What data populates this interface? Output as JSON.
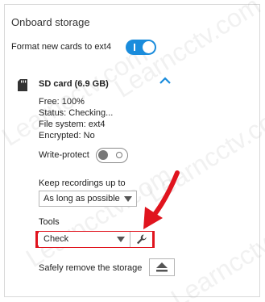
{
  "storage": {
    "title": "Onboard storage",
    "format_label": "Format new cards to ext4",
    "format_enabled": true
  },
  "sd_card": {
    "title": "SD card (6.9 GB)",
    "expanded": true,
    "info": [
      "Free: 100%",
      "Status: Checking...",
      "File system: ext4",
      "Encrypted: No"
    ],
    "write_protect_label": "Write-protect",
    "write_protect_enabled": false,
    "keep_label": "Keep recordings up to",
    "keep_value": "As long as possible",
    "tools_label": "Tools",
    "tools_value": "Check",
    "remove_label": "Safely remove the storage"
  },
  "icons": {
    "sd": "sd-card-icon",
    "chevron": "chevron-up-icon",
    "wrench": "wrench-icon",
    "eject": "eject-icon"
  },
  "colors": {
    "accent": "#1a8cdc",
    "highlight": "#e0141e"
  },
  "watermark_text": "Learncctv.com"
}
